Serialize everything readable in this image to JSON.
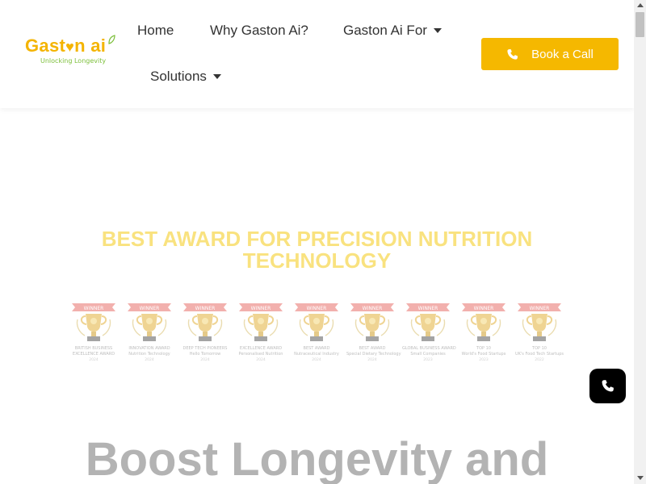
{
  "logo": {
    "name_part1": "Gast",
    "name_part2": "n ai",
    "tagline": "Unlocking Longevity"
  },
  "nav": {
    "items": [
      {
        "label": "Home",
        "has_dropdown": false
      },
      {
        "label": "Why Gaston Ai?",
        "has_dropdown": false
      },
      {
        "label": "Gaston Ai For",
        "has_dropdown": true
      },
      {
        "label": "Solutions",
        "has_dropdown": true
      }
    ],
    "cta_label": "Book a Call"
  },
  "awards_section": {
    "title_line1": "BEST AWARD FOR PRECISION NUTRITION",
    "title_line2": "TECHNOLOGY",
    "ribbon_text": "WINNER",
    "awards": [
      {
        "cap1": "BRITISH BUSINESS",
        "cap2": "EXCELLENCE AWARD",
        "year": "2024"
      },
      {
        "cap1": "INNOVATION AWARD",
        "cap2": "Nutrition Technology",
        "year": "2024"
      },
      {
        "cap1": "DEEP TECH PIONEERS",
        "cap2": "Hello Tomorrow",
        "year": "2024"
      },
      {
        "cap1": "EXCELLENCE AWARD",
        "cap2": "Personalised Nutrition",
        "year": "2024"
      },
      {
        "cap1": "BEST AWARD",
        "cap2": "Nutraceutical Industry",
        "year": "2024"
      },
      {
        "cap1": "BEST AWARD",
        "cap2": "Special Dietary Technology",
        "year": "2024"
      },
      {
        "cap1": "GLOBAL BUSINESS AWARD",
        "cap2": "Small Companies",
        "year": "2023"
      },
      {
        "cap1": "TOP 10",
        "cap2": "World's Food Startups",
        "year": "2023"
      },
      {
        "cap1": "TOP 10",
        "cap2": "UK's Food Tech Startups",
        "year": "2022"
      }
    ]
  },
  "hero": {
    "headline": "Boost Longevity and"
  },
  "colors": {
    "brand_yellow": "#f5b800",
    "title_yellow": "#f9e27f",
    "logo_green": "#7cbf3a",
    "ribbon_red": "#e8706b"
  }
}
